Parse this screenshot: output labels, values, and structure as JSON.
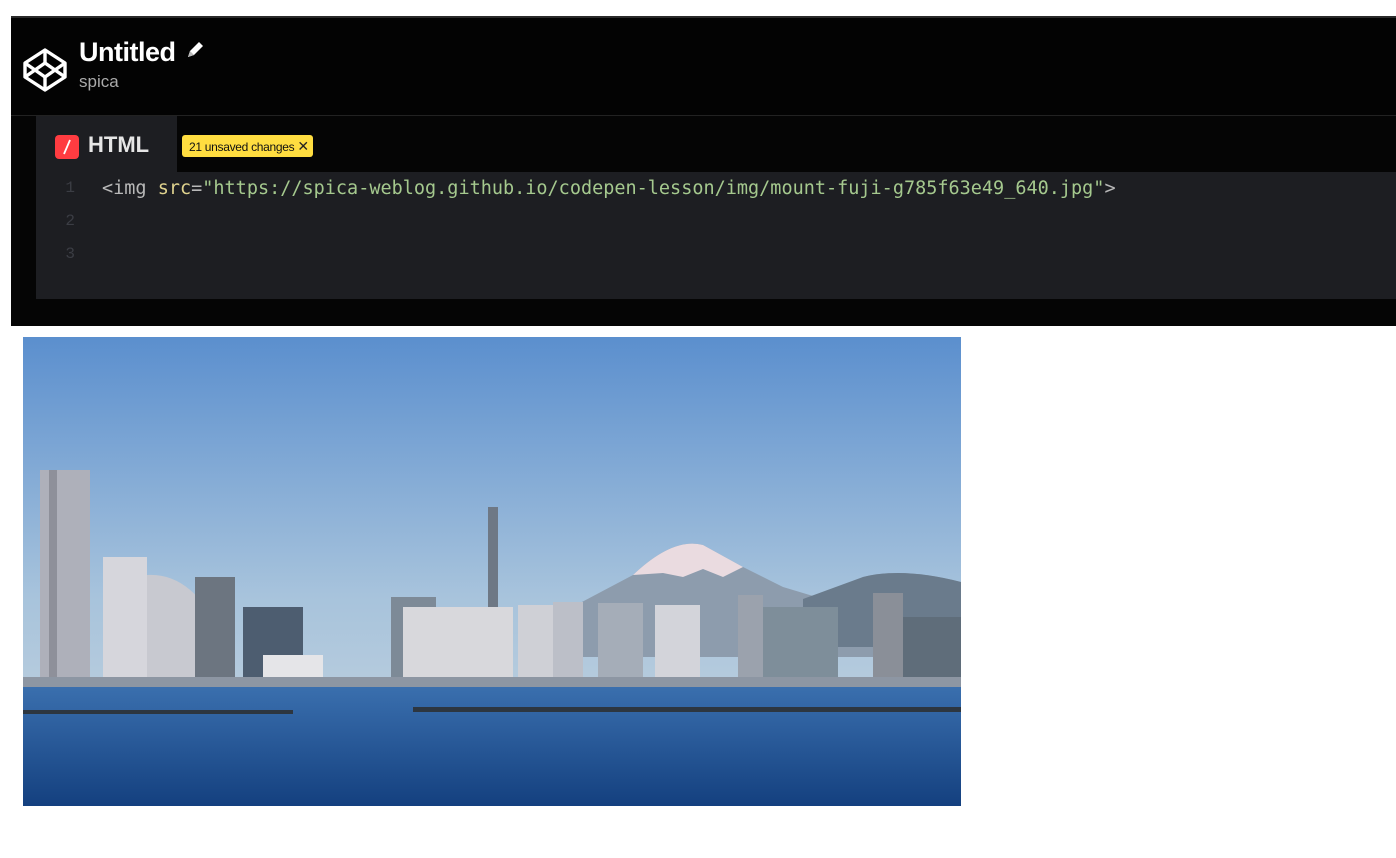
{
  "header": {
    "title": "Untitled",
    "owner": "spica"
  },
  "editor": {
    "tab_label": "HTML",
    "unsaved_badge": "21 unsaved changes",
    "badge_close": "✕",
    "line_numbers": [
      "1",
      "2",
      "3"
    ],
    "code": {
      "tag_open": "<img",
      "attr_name": "src",
      "equals": "=",
      "attr_value": "\"https://spica-weblog.github.io/codepen-lesson/img/mount-fuji-g785f63e49_640.jpg\"",
      "tag_close": ">"
    }
  },
  "preview": {
    "image_description": "Yokohama skyline with Mount Fuji"
  },
  "colors": {
    "header_bg": "#030303",
    "editor_bg": "#1d1e22",
    "html_icon": "#ff3c41",
    "badge_bg": "#ffdd40"
  },
  "icons": [
    "codepen-logo-icon",
    "pencil-icon",
    "html-language-icon",
    "close-icon"
  ]
}
